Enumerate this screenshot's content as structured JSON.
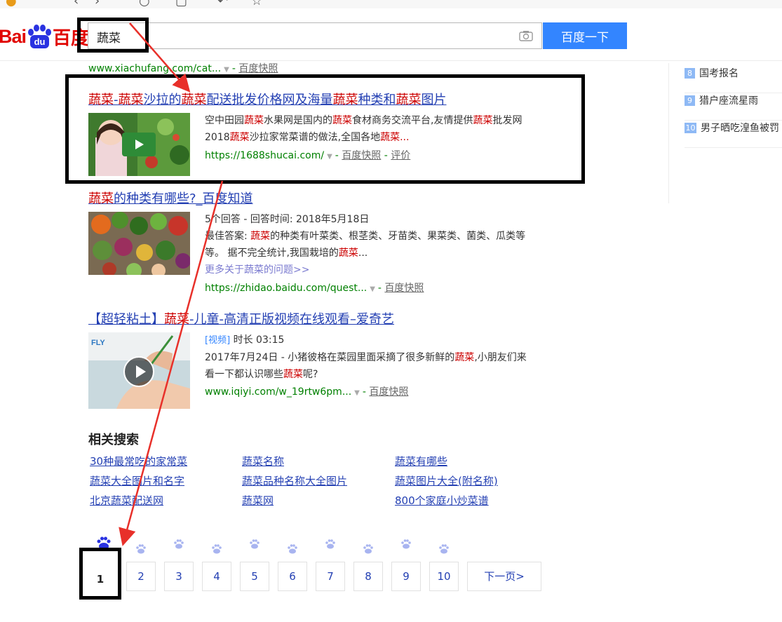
{
  "search": {
    "query": "蔬菜",
    "button_label": "百度一下"
  },
  "logo": {
    "bai": "Bai",
    "du_pad": "du",
    "baidu_cn": "百度"
  },
  "results": [
    {
      "url_partial": "www.xiachufang.com/cat...",
      "kuaizhao": "百度快照"
    },
    {
      "title_parts": [
        "蔬菜",
        "-",
        "蔬菜",
        "沙拉的",
        "蔬菜",
        "配送批发价格网及海量",
        "蔬菜",
        "种类和",
        "蔬菜",
        "图片"
      ],
      "snippet_parts": [
        "空中田园",
        "蔬菜",
        "水果网是国内的",
        "蔬菜",
        "食材商务交流平台,友情提供",
        "蔬菜",
        "批发网2018",
        "蔬菜",
        "沙拉家常菜谱的做法,全国各地",
        "蔬菜",
        "..."
      ],
      "url": "https://1688shucai.com/",
      "kuaizhao": "百度快照",
      "pingjia": "评价"
    },
    {
      "title_parts": [
        "蔬菜",
        "的种类有哪些?_百度知道"
      ],
      "meta": "5个回答 - 回答时间: 2018年5月18日",
      "snippet_parts": [
        "最佳答案: ",
        "蔬菜",
        "的种类有叶菜类、根茎类、牙苗类、果菜类、菌类、瓜类等等。 据不完全统计,我国栽培的",
        "蔬菜",
        "..."
      ],
      "more_link": "更多关于蔬菜的问题>>",
      "url": "https://zhidao.baidu.com/quest...",
      "kuaizhao": "百度快照"
    },
    {
      "title_parts": [
        "【超轻粘土】",
        "蔬菜",
        "-儿童-高清正版视频在线观看–爱奇艺"
      ],
      "video_tag": "[视频]",
      "duration": "时长 03:15",
      "snippet_parts": [
        "2017年7月24日 - 小猪彼格在菜园里面采摘了很多新鲜的",
        "蔬菜",
        ",小朋友们来看一下都认识哪些",
        "蔬菜",
        "呢?"
      ],
      "url": "www.iqiyi.com/w_19rtw6pm...",
      "kuaizhao": "百度快照",
      "thumb_logo": "FLY"
    }
  ],
  "sidebar": {
    "items": [
      {
        "num": "8",
        "label": "国考报名"
      },
      {
        "num": "9",
        "label": "猎户座流星雨"
      },
      {
        "num": "10",
        "label": "男子晒吃湟鱼被罚"
      }
    ]
  },
  "related": {
    "title": "相关搜索",
    "links": [
      "30种最常吃的家常菜",
      "蔬菜名称",
      "蔬菜有哪些",
      "蔬菜大全图片和名字",
      "蔬菜品种名称大全图片",
      "蔬菜图片大全(附名称)",
      "北京蔬菜配送网",
      "蔬菜网",
      "800个家庭小炒菜谱"
    ]
  },
  "pagination": {
    "current": "1",
    "pages": [
      "2",
      "3",
      "4",
      "5",
      "6",
      "7",
      "8",
      "9",
      "10"
    ],
    "next_label": "下一页>"
  },
  "colors": {
    "accent": "#3385ff",
    "highlight_red": "#c00",
    "link": "#2440b3",
    "url_green": "#008000",
    "annotation_red": "#e8302a"
  }
}
